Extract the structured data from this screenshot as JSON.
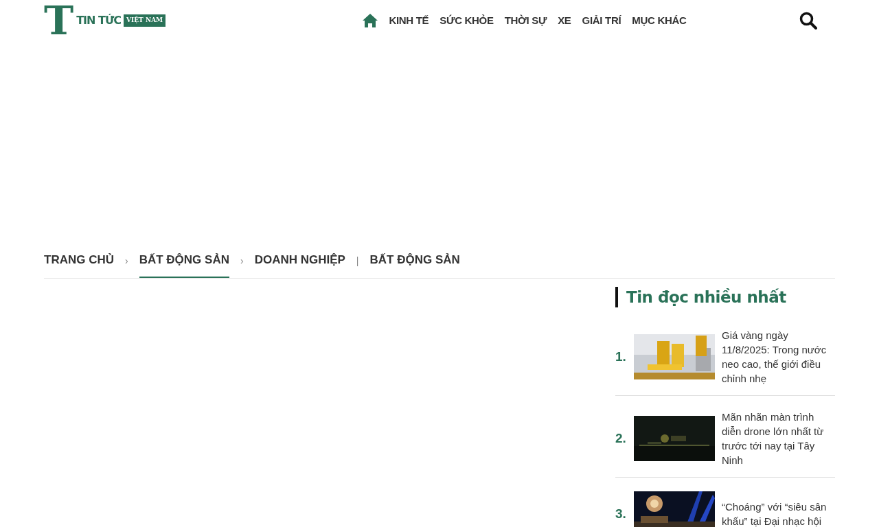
{
  "header": {
    "logo": {
      "letter": "T",
      "name": "TIN TỨC",
      "tag": "VIỆT NAM"
    },
    "nav": [
      {
        "label": "KINH TẾ"
      },
      {
        "label": "SỨC KHỎE"
      },
      {
        "label": "THỜI SỰ"
      },
      {
        "label": "XE"
      },
      {
        "label": "GIẢI TRÍ"
      },
      {
        "label": "MỤC KHÁC"
      }
    ]
  },
  "breadcrumb": [
    {
      "label": "TRANG CHỦ",
      "selected": false,
      "separator": "›"
    },
    {
      "label": "BẤT ĐỘNG SẢN",
      "selected": true,
      "separator": "›"
    },
    {
      "label": "DOANH NGHIỆP",
      "selected": false,
      "separator": "|"
    },
    {
      "label": "BẤT ĐỘNG SẢN",
      "selected": false
    }
  ],
  "most_read": {
    "title": "Tin đọc nhiều nhất",
    "items": [
      {
        "rank": "1.",
        "kind": "picture",
        "title": "Giá vàng ngày 11/8/2025: Trong nước neo cao, thế giới điều chỉnh nhẹ"
      },
      {
        "rank": "2.",
        "kind": "picture",
        "title": "Mãn nhãn màn trình diễn drone lớn nhất từ trước tới nay tại Tây Ninh"
      },
      {
        "rank": "3.",
        "kind": "picture",
        "title": "“Choáng” với “siêu sân khấu” tại Đại nhạc hội"
      }
    ]
  }
}
